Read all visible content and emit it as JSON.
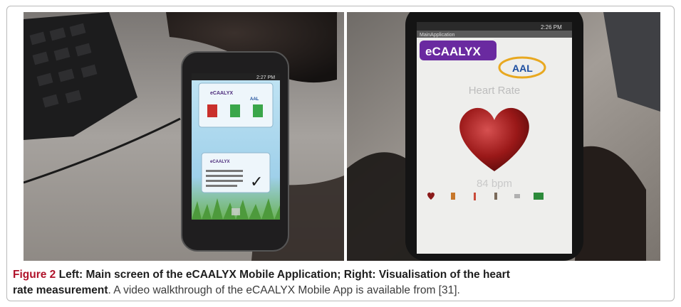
{
  "figure": {
    "label": "Figure 2",
    "title_bold_1": " Left: Main screen of the eCAALYX Mobile Application; Right: Visualisation of the heart",
    "title_bold_2": "rate measurement",
    "caption_rest": ". A video walkthrough of the eCAALYX Mobile App is available from [31]."
  },
  "left_phone": {
    "status_time": "2:27 PM",
    "logo_text": "eCAALYX",
    "aal_text": "AAL",
    "check_glyph": "✓"
  },
  "right_phone": {
    "status_time": "2:26 PM",
    "title_bar": "MainApplication",
    "logo_text": "eCAALYX",
    "aal_text": "AAL",
    "heart_rate_label": "Heart Rate",
    "bpm_value": "84 bpm"
  }
}
